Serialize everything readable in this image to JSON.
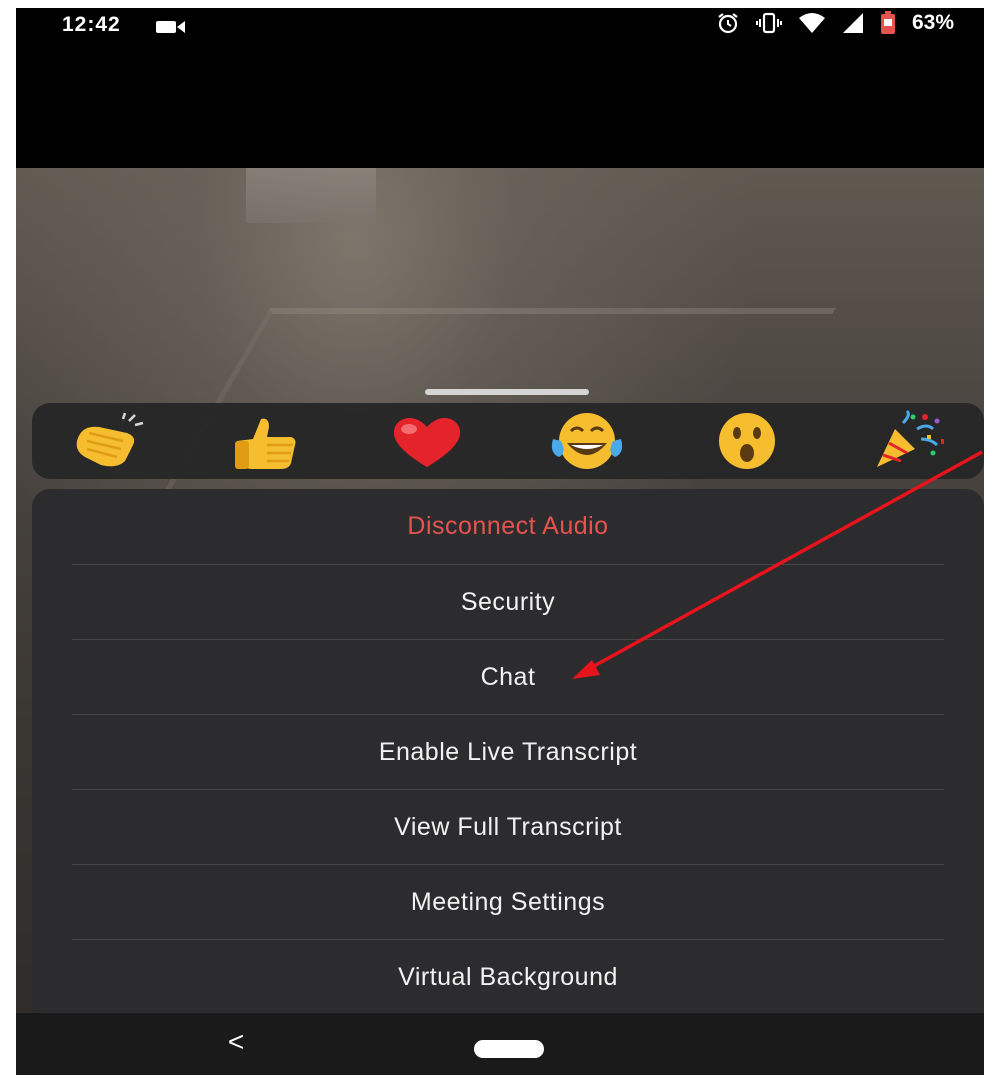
{
  "status_bar": {
    "time": "12:42",
    "battery": "63%",
    "icons": [
      "video-camera-icon",
      "alarm-icon",
      "vibrate-icon",
      "wifi-icon",
      "signal-icon",
      "battery-icon"
    ]
  },
  "reactions": [
    {
      "name": "clap-icon",
      "emoji": "👏"
    },
    {
      "name": "thumbs-up-icon",
      "emoji": "👍"
    },
    {
      "name": "heart-icon",
      "emoji": "❤"
    },
    {
      "name": "tears-of-joy-icon",
      "emoji": "😂"
    },
    {
      "name": "surprised-icon",
      "emoji": "😮"
    },
    {
      "name": "party-popper-icon",
      "emoji": "🎉"
    }
  ],
  "menu": {
    "items": [
      {
        "label": "Disconnect Audio",
        "style": "danger"
      },
      {
        "label": "Security"
      },
      {
        "label": "Chat"
      },
      {
        "label": "Enable Live Transcript"
      },
      {
        "label": "View Full Transcript"
      },
      {
        "label": "Meeting Settings"
      },
      {
        "label": "Virtual Background"
      }
    ]
  },
  "nav": {
    "back_symbol": "<"
  },
  "colors": {
    "danger": "#e5534f",
    "menu_bg": "#2c2c2e",
    "annotation_arrow": "#e8131b"
  }
}
